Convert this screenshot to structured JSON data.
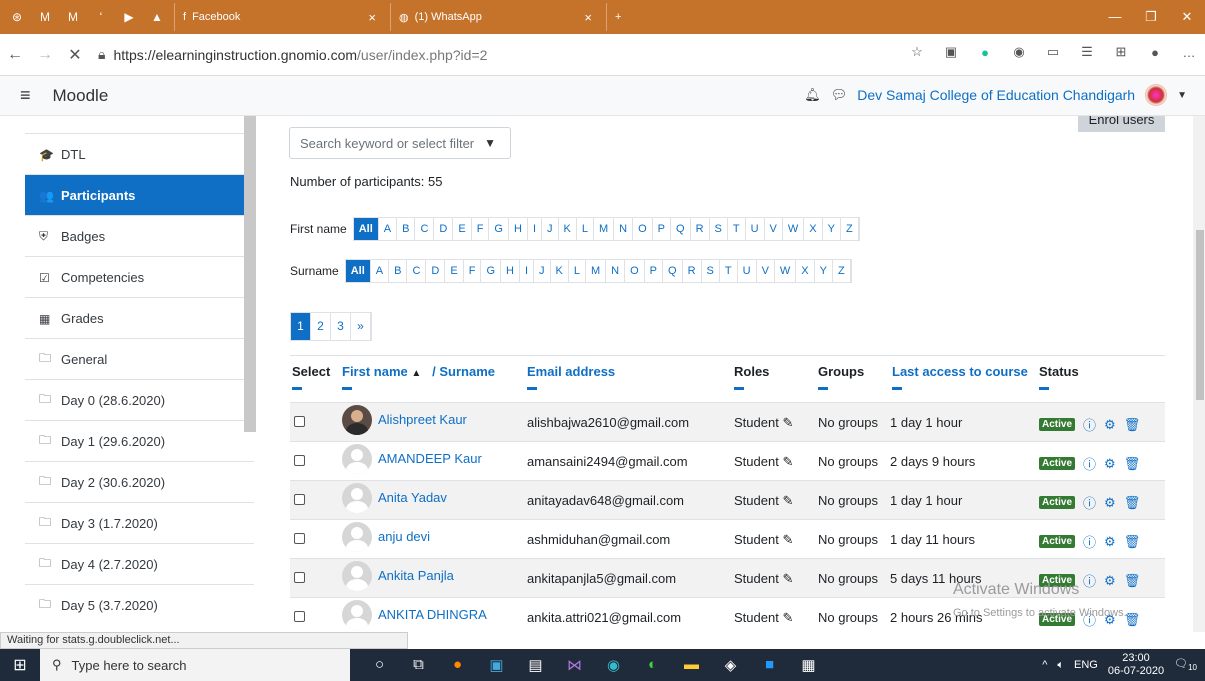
{
  "browser": {
    "tabs": [
      {
        "label": "Facebook",
        "icon": "facebook-icon"
      },
      {
        "label": "(1) WhatsApp",
        "icon": "whatsapp-icon"
      }
    ],
    "new_tab": "+",
    "url_host": "https://elearninginstruction.gnomio.com",
    "url_path": "/user/index.php?id=2"
  },
  "navbar": {
    "brand": "Moodle",
    "user": "Dev Samaj College of Education Chandigarh"
  },
  "sidebar": {
    "items": [
      {
        "label": "DTL",
        "icon": "graduation-cap-icon",
        "glyph": "🎓"
      },
      {
        "label": "Participants",
        "icon": "users-icon",
        "glyph": "👥",
        "active": true
      },
      {
        "label": "Badges",
        "icon": "shield-icon",
        "glyph": "⛨"
      },
      {
        "label": "Competencies",
        "icon": "checkbox-icon",
        "glyph": "☑"
      },
      {
        "label": "Grades",
        "icon": "table-icon",
        "glyph": "▦"
      },
      {
        "label": "General",
        "icon": "folder-icon",
        "glyph": "🗀"
      },
      {
        "label": "Day 0 (28.6.2020)",
        "icon": "folder-icon",
        "glyph": "🗀"
      },
      {
        "label": "Day 1 (29.6.2020)",
        "icon": "folder-icon",
        "glyph": "🗀"
      },
      {
        "label": "Day 2 (30.6.2020)",
        "icon": "folder-icon",
        "glyph": "🗀"
      },
      {
        "label": "Day 3 (1.7.2020)",
        "icon": "folder-icon",
        "glyph": "🗀"
      },
      {
        "label": "Day 4 (2.7.2020)",
        "icon": "folder-icon",
        "glyph": "🗀"
      },
      {
        "label": "Day 5 (3.7.2020)",
        "icon": "folder-icon",
        "glyph": "🗀"
      }
    ]
  },
  "main": {
    "search_placeholder": "Search keyword or select filter",
    "enrol_button": "Enrol users",
    "participant_count": "Number of participants: 55",
    "firstname_label": "First name",
    "surname_label": "Surname",
    "letters": [
      "All",
      "A",
      "B",
      "C",
      "D",
      "E",
      "F",
      "G",
      "H",
      "I",
      "J",
      "K",
      "L",
      "M",
      "N",
      "O",
      "P",
      "Q",
      "R",
      "S",
      "T",
      "U",
      "V",
      "W",
      "X",
      "Y",
      "Z"
    ],
    "pages": [
      "1",
      "2",
      "3",
      "»"
    ],
    "columns": {
      "select": "Select",
      "firstname": "First name",
      "surname": "/ Surname",
      "email": "Email address",
      "roles": "Roles",
      "groups": "Groups",
      "last_access": "Last access to course",
      "status": "Status"
    },
    "rows": [
      {
        "name": "Alishpreet Kaur",
        "email": "alishbajwa2610@gmail.com",
        "role": "Student",
        "groups": "No groups",
        "access": "1 day 1 hour",
        "status": "Active",
        "photo": true
      },
      {
        "name": "AMANDEEP Kaur",
        "email": "amansaini2494@gmail.com",
        "role": "Student",
        "groups": "No groups",
        "access": "2 days 9 hours",
        "status": "Active",
        "photo": false
      },
      {
        "name": "Anita Yadav",
        "email": "anitayadav648@gmail.com",
        "role": "Student",
        "groups": "No groups",
        "access": "1 day 1 hour",
        "status": "Active",
        "photo": false
      },
      {
        "name": "anju devi",
        "email": "ashmiduhan@gmail.com",
        "role": "Student",
        "groups": "No groups",
        "access": "1 day 11 hours",
        "status": "Active",
        "photo": false
      },
      {
        "name": "Ankita Panjla",
        "email": "ankitapanjla5@gmail.com",
        "role": "Student",
        "groups": "No groups",
        "access": "5 days 11 hours",
        "status": "Active",
        "photo": false
      },
      {
        "name": "ANKITA DHINGRA",
        "email": "ankita.attri021@gmail.com",
        "role": "Student",
        "groups": "No groups",
        "access": "2 hours 26 mins",
        "status": "Active",
        "photo": false
      }
    ]
  },
  "watermark": {
    "title": "Activate Windows",
    "subtitle": "Go to Settings to activate Windows."
  },
  "statusbar": "Waiting for stats.g.doubleclick.net...",
  "taskbar": {
    "search_placeholder": "Type here to search",
    "lang": "ENG",
    "time": "23:00",
    "date": "06-07-2020",
    "notifications": "10"
  }
}
